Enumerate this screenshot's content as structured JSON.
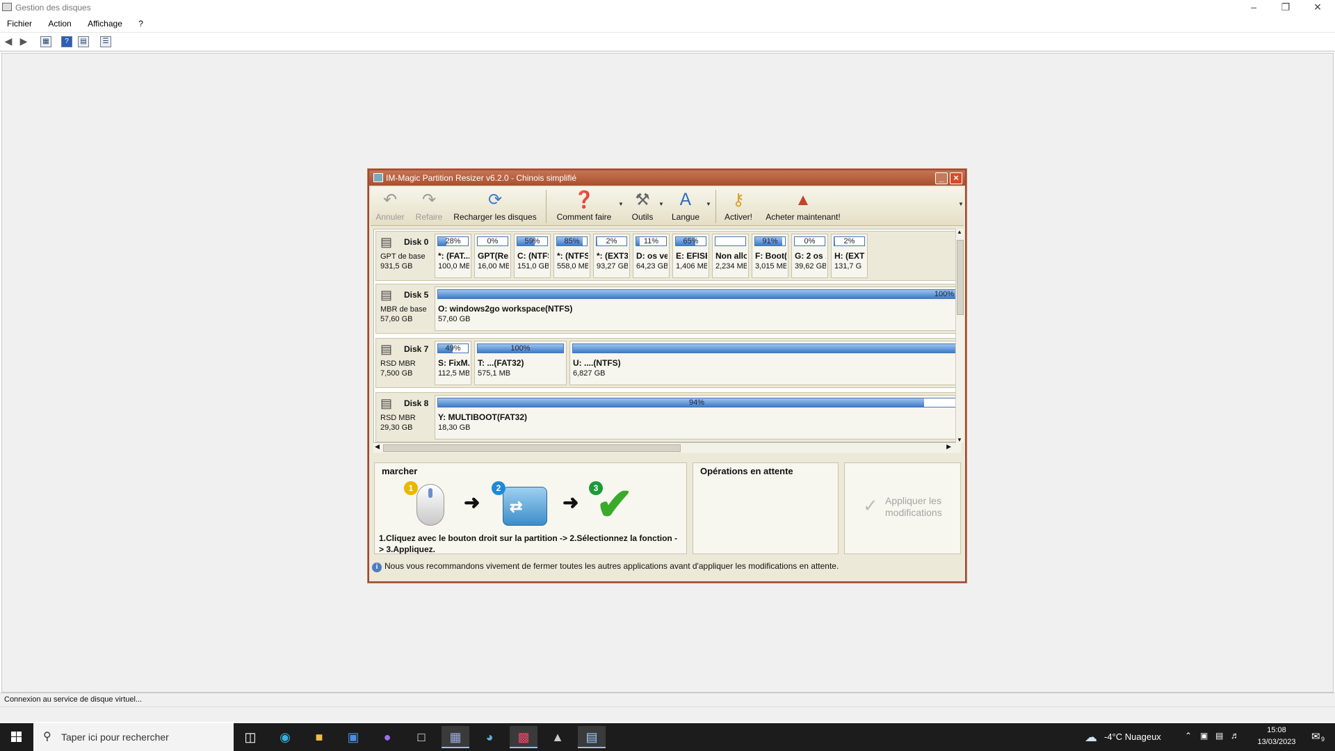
{
  "window": {
    "title": "Gestion des disques"
  },
  "menu": [
    "Fichier",
    "Action",
    "Affichage",
    "?"
  ],
  "status_text": "Connexion au service de disque virtuel...",
  "dialog": {
    "title": "IM-Magic Partition Resizer v6.2.0 - Chinois simplifié",
    "toolbar": {
      "undo": "Annuler",
      "redo": "Refaire",
      "reload": "Recharger les disques",
      "howto": "Comment faire",
      "tools": "Outils",
      "language": "Langue",
      "activate": "Activer!",
      "buy": "Acheter maintenant!"
    },
    "disks": [
      {
        "name": "Disk 0",
        "type": "GPT de base",
        "size": "931,5 GB",
        "partitions": [
          {
            "label": "*: (FAT...",
            "size": "100,0 MB",
            "pct": "28%",
            "fill": 0.28
          },
          {
            "label": "GPT(Re...",
            "size": "16,00 MB",
            "pct": "0%",
            "fill": 0.0
          },
          {
            "label": "C: (NTFS)",
            "size": "151,0 GB",
            "pct": "59%",
            "fill": 0.59
          },
          {
            "label": "*: (NTFS)",
            "size": "558,0 MB",
            "pct": "85%",
            "fill": 0.85
          },
          {
            "label": "*: (EXT3)",
            "size": "93,27 GB",
            "pct": "2%",
            "fill": 0.02
          },
          {
            "label": "D: os ve...",
            "size": "64,23 GB",
            "pct": "11%",
            "fill": 0.11
          },
          {
            "label": "E: EFISE...",
            "size": "1,406 MB",
            "pct": "65%",
            "fill": 0.65
          },
          {
            "label": "Non allo...",
            "size": "2,234 MB",
            "pct": "",
            "fill": 0.0
          },
          {
            "label": "F: Boot(...",
            "size": "3,015 MB",
            "pct": "91%",
            "fill": 0.91
          },
          {
            "label": "G: 2 os ...",
            "size": "39,62 GB",
            "pct": "0%",
            "fill": 0.0
          },
          {
            "label": "H: (EXT",
            "size": "131,7 G",
            "pct": "2%",
            "fill": 0.02
          }
        ]
      },
      {
        "name": "Disk 5",
        "type": "MBR de base",
        "size": "57,60 GB",
        "partitions": [
          {
            "label": "O: windows2go workspace(NTFS)",
            "size": "57,60 GB",
            "pct": "100%",
            "fill": 1.0
          }
        ]
      },
      {
        "name": "Disk 7",
        "type": "RSD MBR",
        "size": "7,500 GB",
        "partitions": [
          {
            "label": "S: FixM...",
            "size": "112,5 MB",
            "pct": "49%",
            "fill": 0.49
          },
          {
            "label": "T: ...(FAT32)",
            "size": "575,1 MB",
            "pct": "100%",
            "fill": 1.0
          },
          {
            "label": "U: ....(NTFS)",
            "size": "6,827 GB",
            "pct": "",
            "fill": 1.0
          }
        ]
      },
      {
        "name": "Disk 8",
        "type": "RSD MBR",
        "size": "29,30 GB",
        "partitions": [
          {
            "label": "Y: MULTIBOOT(FAT32)",
            "size": "18,30 GB",
            "pct": "94%",
            "fill": 0.94
          }
        ]
      }
    ],
    "steps_panel": {
      "header": "marcher",
      "badges": [
        "1",
        "2",
        "3"
      ],
      "text": "1.Cliquez avec le bouton droit sur la partition -> 2.Sélectionnez la fonction -> 3.Appliquez."
    },
    "pending_panel": {
      "header": "Opérations en attente"
    },
    "apply_button": "Appliquer les modifications",
    "tip": "Nous vous recommandons vivement de fermer toutes les autres applications avant d'appliquer les modifications en attente."
  },
  "taskbar": {
    "search_placeholder": "Taper ici pour rechercher",
    "weather": "-4°C  Nuageux",
    "time": "15:08",
    "date": "13/03/2023",
    "notif_count": "9"
  },
  "colors": {
    "accent_bar": "#3d7cc9",
    "dialog_frame": "#9a4a3a",
    "taskbar": "#1c1c1c"
  }
}
